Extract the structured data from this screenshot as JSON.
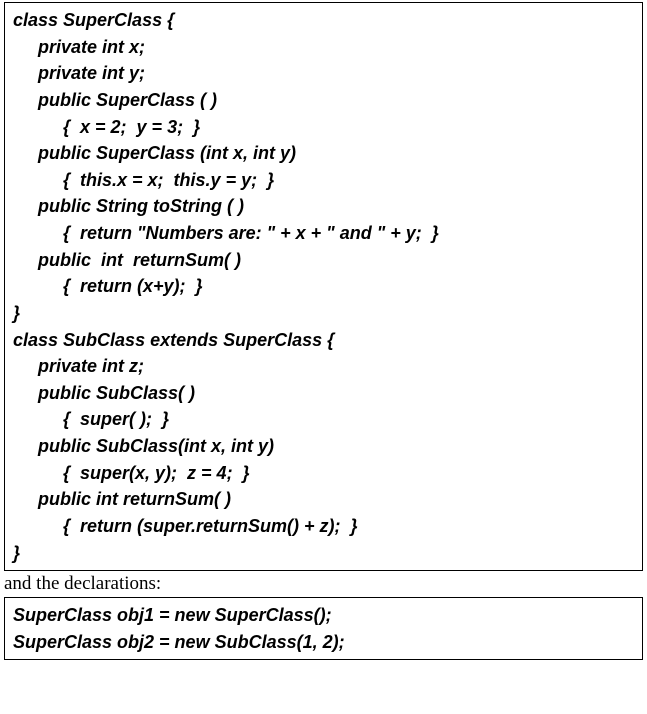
{
  "code_block_1": "class SuperClass {\n     private int x;\n     private int y;\n     public SuperClass ( )\n          {  x = 2;  y = 3;  }\n     public SuperClass (int x, int y)\n          {  this.x = x;  this.y = y;  }\n     public String toString ( )\n          {  return \"Numbers are: \" + x + \" and \" + y;  }\n     public  int  returnSum( )\n          {  return (x+y);  }\n}\nclass SubClass extends SuperClass {\n     private int z;\n     public SubClass( )\n          {  super( );  }\n     public SubClass(int x, int y)\n          {  super(x, y);  z = 4;  }\n     public int returnSum( )\n          {  return (super.returnSum() + z);  }\n}",
  "between_text": "and the declarations:",
  "code_block_2": "SuperClass obj1 = new SuperClass();\nSuperClass obj2 = new SubClass(1, 2);"
}
